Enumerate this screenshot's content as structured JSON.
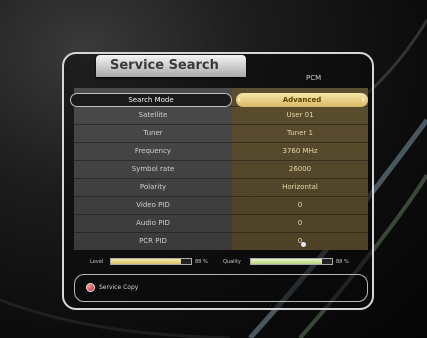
{
  "header": {
    "title": "Service Search",
    "mode_label": "PCM"
  },
  "rows": [
    {
      "label": "Search Mode",
      "value": "Advanced"
    },
    {
      "label": "Satellite",
      "value": "User 01"
    },
    {
      "label": "Tuner",
      "value": "Tuner 1"
    },
    {
      "label": "Frequency",
      "value": "3760 MHz"
    },
    {
      "label": "Symbol rate",
      "value": "26000"
    },
    {
      "label": "Polarity",
      "value": "Horizontal"
    },
    {
      "label": "Video PID",
      "value": "0"
    },
    {
      "label": "Audio PID",
      "value": "0"
    },
    {
      "label": "PCR PID",
      "value": "0"
    }
  ],
  "signal": {
    "level": {
      "label": "Level",
      "percent": 88,
      "percent_text": "88 %"
    },
    "quality": {
      "label": "Quality",
      "percent": 88,
      "percent_text": "88 %"
    }
  },
  "footer": {
    "red_button_label": "Service Copy"
  },
  "colors": {
    "selected_value_bg": "#d7b866",
    "value_column": "#4d4126",
    "label_column": "#3a3a3a",
    "red_button": "#c01010"
  }
}
